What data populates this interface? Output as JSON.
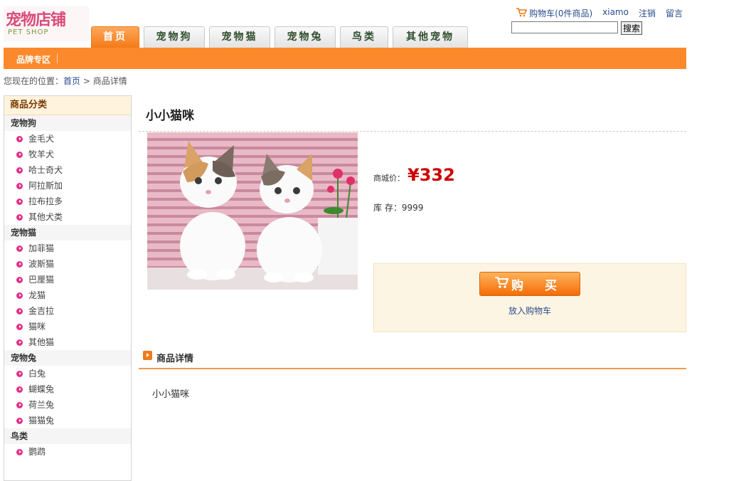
{
  "logo": {
    "text": "宠物店铺",
    "subtitle": "PET SHOP"
  },
  "top_links": {
    "cart": "购物车(0件商品)",
    "user": "xiamo",
    "logout": "注销",
    "message": "留言"
  },
  "search": {
    "value": "",
    "button": "搜索"
  },
  "nav": {
    "tabs": [
      "首页",
      "宠物狗",
      "宠物猫",
      "宠物兔",
      "鸟类",
      "其他宠物"
    ],
    "active": 0
  },
  "sub_nav": {
    "brand": "品牌专区"
  },
  "breadcrumb": {
    "prefix": "您现在的位置：",
    "home": "首页",
    "separator": ">",
    "current": "商品详情"
  },
  "sidebar": {
    "title": "商品分类",
    "groups": [
      {
        "name": "宠物狗",
        "items": [
          "金毛犬",
          "牧羊犬",
          "哈士奇犬",
          "阿拉斯加",
          "拉布拉多",
          "其他犬类"
        ]
      },
      {
        "name": "宠物猫",
        "items": [
          "加菲猫",
          "波斯猫",
          "巴厘猫",
          "龙猫",
          "金吉拉",
          "猫咪",
          "其他猫"
        ]
      },
      {
        "name": "宠物兔",
        "items": [
          "白兔",
          "蝴蝶兔",
          "荷兰兔",
          "猫猫兔"
        ]
      },
      {
        "name": "鸟类",
        "items": [
          "鹦鹉"
        ]
      }
    ]
  },
  "product": {
    "name": "小小猫咪",
    "price_label": "商城价：",
    "price": "¥332",
    "stock_label": "库 存：",
    "stock": "9999",
    "buy_button": "购 买",
    "add_to_cart": "放入购物车",
    "image_caption": "两只小猫"
  },
  "detail": {
    "title": "商品详情",
    "text": "小小猫咪"
  },
  "colors": {
    "accent": "#fc8a2c",
    "price": "#cc0000",
    "bullet": "#e4308a",
    "link": "#2a4b8d"
  }
}
